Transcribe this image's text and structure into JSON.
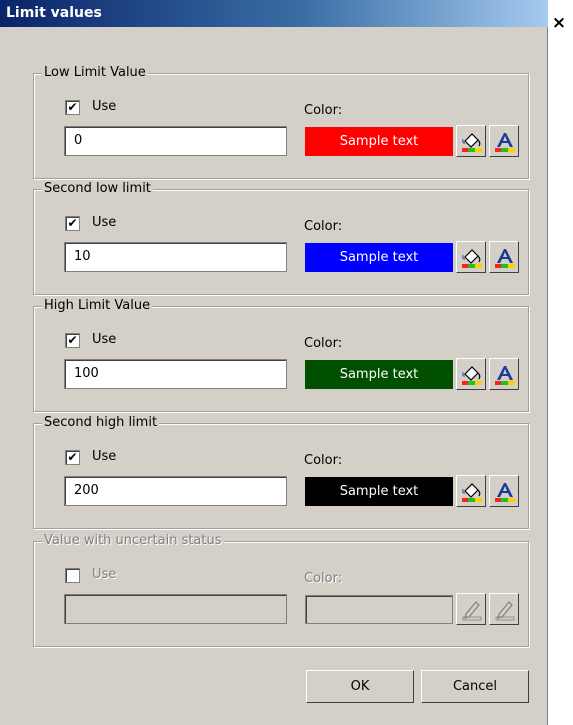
{
  "window": {
    "title": "Limit values",
    "close_label": "×"
  },
  "groups": [
    {
      "legend": "Low Limit Value",
      "use_label": "Use",
      "checked": "✔",
      "color_label": "Color:",
      "value": "0",
      "sample": "Sample text",
      "sample_color": "#ff0000"
    },
    {
      "legend": "Second low limit",
      "use_label": "Use",
      "checked": "✔",
      "color_label": "Color:",
      "value": "10",
      "sample": "Sample text",
      "sample_color": "#0000ff"
    },
    {
      "legend": "High Limit Value",
      "use_label": "Use",
      "checked": "✔",
      "color_label": "Color:",
      "value": "100",
      "sample": "Sample text",
      "sample_color": "#005000"
    },
    {
      "legend": "Second high limit",
      "use_label": "Use",
      "checked": "✔",
      "color_label": "Color:",
      "value": "200",
      "sample": "Sample text",
      "sample_color": "#000000"
    },
    {
      "legend": "Value with uncertain status",
      "use_label": "Use",
      "checked": "",
      "color_label": "Color:",
      "value": "",
      "sample": "",
      "sample_color": ""
    }
  ],
  "buttons": {
    "ok": "OK",
    "cancel": "Cancel"
  },
  "icons": {
    "fill": "paint-bucket-icon",
    "font": "font-color-icon",
    "disabled": "edit-disabled-icon"
  }
}
